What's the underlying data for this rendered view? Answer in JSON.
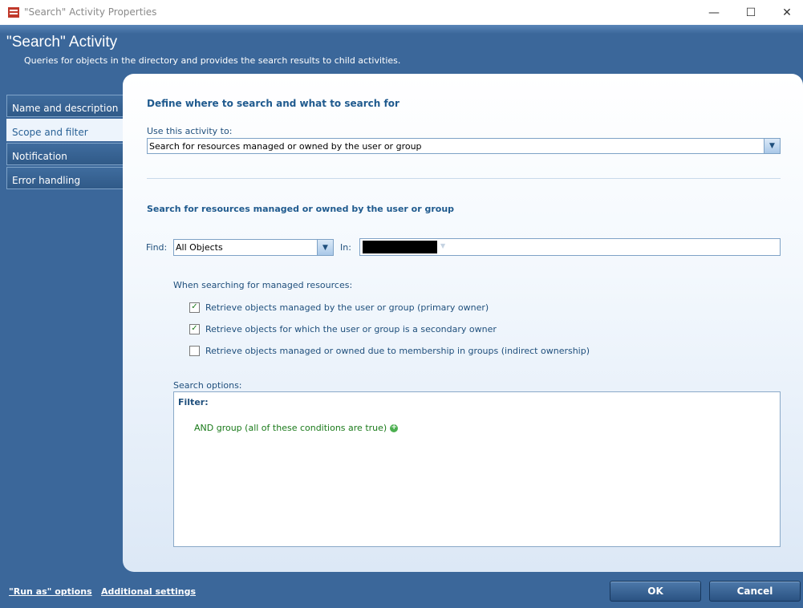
{
  "window": {
    "title": "\"Search\" Activity Properties",
    "minimize_glyph": "—",
    "maximize_glyph": "☐",
    "close_glyph": "✕"
  },
  "header": {
    "title": "\"Search\" Activity",
    "description": "Queries for objects in the directory and provides the search results to child activities."
  },
  "nav": {
    "items": [
      {
        "label": "Name and description"
      },
      {
        "label": "Scope and filter"
      },
      {
        "label": "Notification"
      },
      {
        "label": "Error handling"
      }
    ],
    "active_index": 1
  },
  "main": {
    "heading": "Define where to search and what to search for",
    "use_activity_label": "Use this activity to:",
    "use_activity_value": "Search for resources managed or owned by the user or group",
    "section_heading": "Search for resources managed or owned by the user or group",
    "find_label": "Find:",
    "find_value": "All Objects",
    "in_label": "In:",
    "managed_label": "When searching for managed resources:",
    "checkboxes": [
      {
        "label": "Retrieve objects managed by the user or group (primary owner)",
        "checked": true
      },
      {
        "label": "Retrieve objects for which the user or group is a secondary owner",
        "checked": true
      },
      {
        "label": "Retrieve objects managed or owned due to membership in groups (indirect ownership)",
        "checked": false
      }
    ],
    "search_options_label": "Search options:",
    "filter_label": "Filter:",
    "and_group": "AND group (all of these conditions are true)"
  },
  "footer": {
    "run_as": "\"Run as\" options",
    "additional": "Additional settings",
    "ok": "OK",
    "cancel": "Cancel"
  },
  "icons": {
    "dropdown": "▼",
    "check": "✓",
    "plus": "+"
  },
  "colors": {
    "chrome_blue": "#3b679a",
    "heading_blue": "#1f5a8e",
    "filter_green": "#1a7a1a"
  }
}
